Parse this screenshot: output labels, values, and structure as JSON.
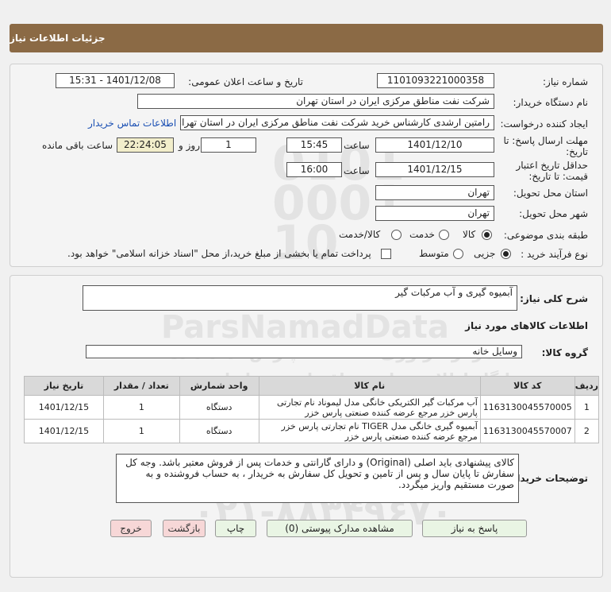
{
  "header": {
    "title": "جزئیات اطلاعات نیاز"
  },
  "need_number": {
    "label": "شماره نیاز:",
    "value": "1101093221000358"
  },
  "announce_datetime": {
    "label": "تاریخ و ساعت اعلان عمومی:",
    "value": "1401/12/08 - 15:31"
  },
  "buyer_org": {
    "label": "نام دستگاه خریدار:",
    "value": "شرکت نفت مناطق مرکزی ایران در استان تهران"
  },
  "requester": {
    "label": "ایجاد کننده درخواست:",
    "value": "رامتین ارشدی کارشناس خرید شرکت نفت مناطق مرکزی ایران در استان تهران",
    "contact_link": "اطلاعات تماس خریدار"
  },
  "response_deadline": {
    "label_line1": "مهلت ارسال پاسخ: تا",
    "label_line2": "تاریخ:",
    "date": "1401/12/10",
    "time_label": "ساعت",
    "time": "15:45",
    "days": "1",
    "days_label": "روز و",
    "remaining": "22:24:05",
    "remaining_label": "ساعت باقی مانده"
  },
  "price_validity": {
    "label_line1": "حداقل تاریخ اعتبار",
    "label_line2": "قیمت: تا تاریخ:",
    "date": "1401/12/15",
    "time_label": "ساعت",
    "time": "16:00"
  },
  "delivery_province": {
    "label": "استان محل تحویل:",
    "value": "تهران"
  },
  "delivery_city": {
    "label": "شهر محل تحویل:",
    "value": "تهران"
  },
  "category": {
    "label": "طبقه بندی موضوعی:",
    "options": [
      "کالا",
      "خدمت",
      "کالا/خدمت"
    ],
    "selected": "کالا"
  },
  "process_type": {
    "label": "نوع فرآیند خرید :",
    "options": [
      "جزیی",
      "متوسط"
    ],
    "selected": "جزیی",
    "payment_note": "پرداخت تمام یا بخشی از مبلغ خرید،از محل \"اسناد خزانه اسلامی\" خواهد بود."
  },
  "general_desc": {
    "label": "شرح کلی نیاز:",
    "value": "آبمیوه گیری و آب مرکبات گیر"
  },
  "goods_info_title": "اطلاعات کالاهای مورد نیاز",
  "goods_group": {
    "label": "گروه کالا:",
    "value": "وسایل خانه"
  },
  "table": {
    "headers": [
      "ردیف",
      "کد کالا",
      "نام کالا",
      "واحد شمارش",
      "تعداد / مقدار",
      "تاریخ نیاز"
    ],
    "rows": [
      {
        "row": "1",
        "code": "1163130045570005",
        "name": "آب مرکبات گیر الکتریکی خانگی مدل لیموناد نام تجارتی پارس خزر مرجع عرضه کننده صنعتی پارس خزر",
        "unit": "دستگاه",
        "qty": "1",
        "date": "1401/12/15"
      },
      {
        "row": "2",
        "code": "1163130045570007",
        "name": "آبمیوه گیری خانگی مدل TIGER نام تجارتی پارس خزر مرجع عرضه کننده صنعتی پارس خزر",
        "unit": "دستگاه",
        "qty": "1",
        "date": "1401/12/15"
      }
    ]
  },
  "buyer_notes": {
    "label": "توضیحات خریدار:",
    "value": "کالای پیشنهادی باید اصلی (Original) و دارای گارانتی و خدمات پس از فروش معتبر باشد. وجه کل سفارش تا پایان سال و پس از تامین و تحویل کل سفارش به خریدار ، به حساب فروشنده و به صورت مستقیم واریز میگردد."
  },
  "buttons": {
    "reply": "پاسخ به نیاز",
    "attachments": "مشاهده مدارک پیوستی (0)",
    "print": "چاپ",
    "back": "بازگشت",
    "exit": "خروج"
  },
  "watermark": {
    "brand": "ParsNamadData",
    "line1": "مرکز فراوری اطلاعات پارس نماد داده",
    "line2": "پایگاه اطلاع رسانی مناقصات و مزایدات",
    "phone": "۰۲۱-۸۸۳۴۹۶۷۰"
  }
}
